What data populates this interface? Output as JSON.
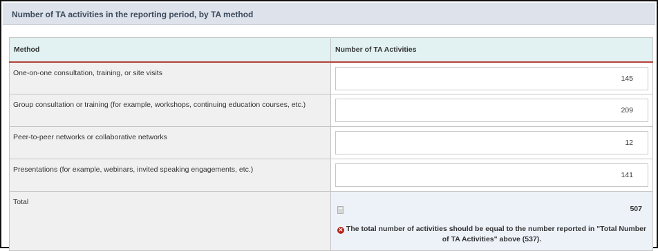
{
  "section": {
    "title": "Number of TA activities in the reporting period, by TA method"
  },
  "table": {
    "headers": {
      "method": "Method",
      "count": "Number of TA Activities"
    },
    "rows": [
      {
        "method": "One-on-one consultation, training, or site visits",
        "value": "145"
      },
      {
        "method": "Group consultation or training (for example, workshops, continuing education courses, etc.)",
        "value": "209"
      },
      {
        "method": "Peer-to-peer networks or collaborative networks",
        "value": "12"
      },
      {
        "method": "Presentations (for example, webinars, invited speaking engagements, etc.)",
        "value": "141"
      }
    ],
    "total": {
      "label": "Total",
      "value": "507",
      "calc_icon": "calculator-icon",
      "error_icon": "error-circle-icon",
      "error_message": "The total number of activities should be equal to the number reported in \"Total Number of TA Activities\" above (537)."
    }
  },
  "colors": {
    "section_header_bg": "#dde2eb",
    "table_header_bg": "#e2f1f1",
    "header_underline": "#b6403a",
    "label_cell_bg": "#f0f0f0",
    "total_cell_bg": "#edf2f9",
    "error_icon": "#b42318"
  }
}
